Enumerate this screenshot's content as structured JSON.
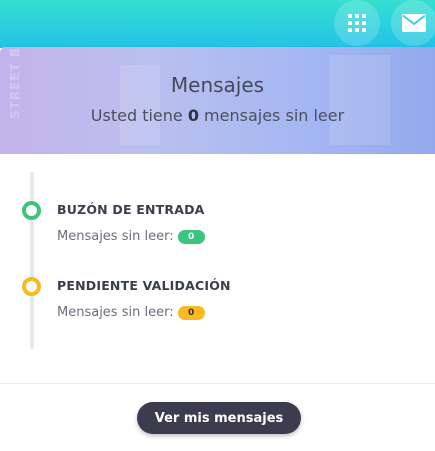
{
  "colors": {
    "topbar_start": "#35e0d0",
    "topbar_end": "#22c2e8",
    "header_gradient_start": "#c5b3ec",
    "header_gradient_end": "#93a9ec",
    "success": "#3ac47d",
    "warning": "#f7b924",
    "button_dark": "#3d3c4e"
  },
  "topbar": {
    "icons": [
      "apps-grid-icon",
      "mail-icon"
    ]
  },
  "header": {
    "title": "Mensajes",
    "subtitle_prefix": "Usted tiene ",
    "unread_count": "0",
    "subtitle_suffix": " mensajes sin leer",
    "background_text": "STREET BAS"
  },
  "timeline": [
    {
      "title": "BUZÓN DE ENTRADA",
      "label": "Mensajes sin leer:",
      "count": "0",
      "status": "success"
    },
    {
      "title": "PENDIENTE VALIDACIÓN",
      "label": "Mensajes sin leer:",
      "count": "0",
      "status": "warning"
    }
  ],
  "footer": {
    "button_label": "Ver mis mensajes"
  }
}
